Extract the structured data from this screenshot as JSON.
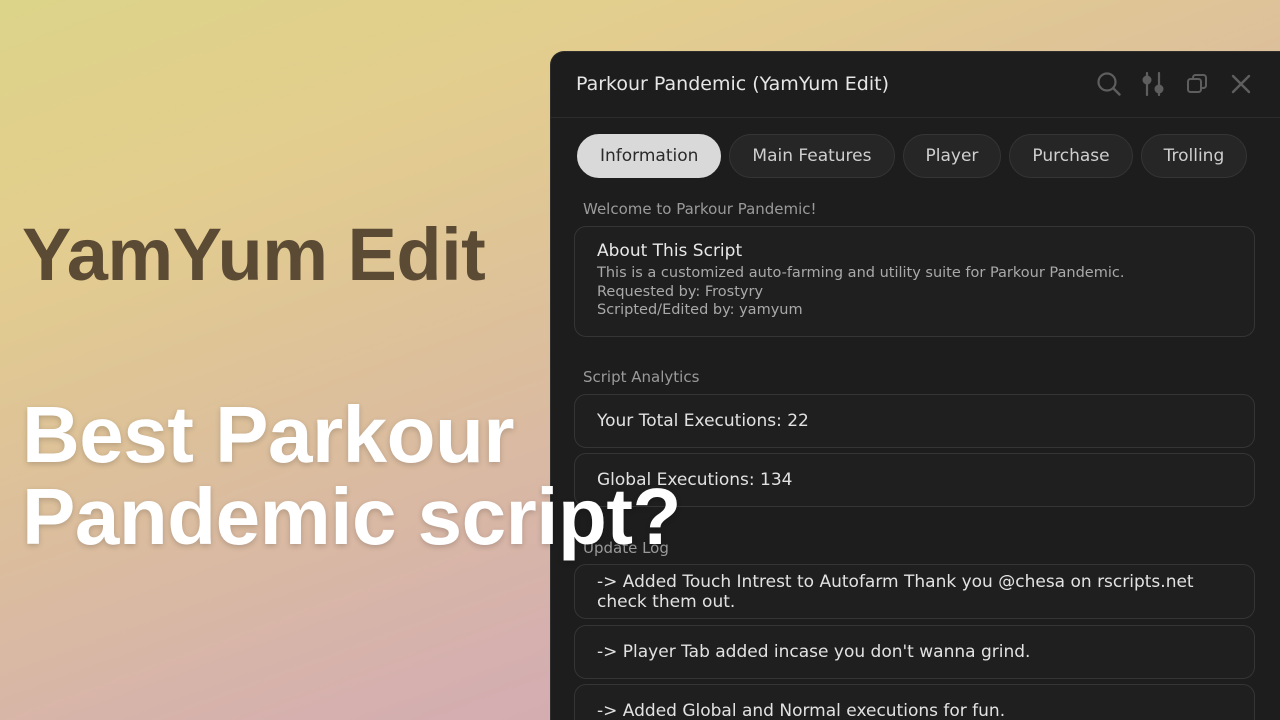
{
  "thumbnail": {
    "subtitle": "YamYum Edit",
    "headline_line1": "Best Parkour",
    "headline_line2": "Pandemic script?"
  },
  "window": {
    "title": "Parkour Pandemic (YamYum Edit)",
    "controls": [
      "search-icon",
      "settings-sliders-icon",
      "restore-icon",
      "close-icon"
    ]
  },
  "tabs": [
    {
      "label": "Information",
      "active": true
    },
    {
      "label": "Main Features",
      "active": false
    },
    {
      "label": "Player",
      "active": false
    },
    {
      "label": "Purchase",
      "active": false
    },
    {
      "label": "Trolling",
      "active": false
    }
  ],
  "welcome": {
    "label": "Welcome to Parkour Pandemic!",
    "card_title": "About This Script",
    "lines": [
      "This is a customized auto-farming and utility suite for Parkour Pandemic.",
      "Requested by: Frostyry",
      "Scripted/Edited by: yamyum"
    ]
  },
  "analytics": {
    "label": "Script Analytics",
    "total": "Your Total Executions: 22",
    "global": "Global Executions: 134"
  },
  "update_log": {
    "label": "Update Log",
    "entries": [
      [
        "-> Added Touch Intrest to Autofarm Thank you @chesa on rscripts.net",
        "check them out."
      ],
      "-> Player Tab added incase you don't wanna grind.",
      "-> Added Global and Normal executions for fun."
    ]
  },
  "colors": {
    "window_bg": "#1d1d1d",
    "card_border": "#353535",
    "active_tab": "#d9d9d9",
    "headline_white": "#ffffff",
    "headline_brown": "#5b4a34"
  }
}
